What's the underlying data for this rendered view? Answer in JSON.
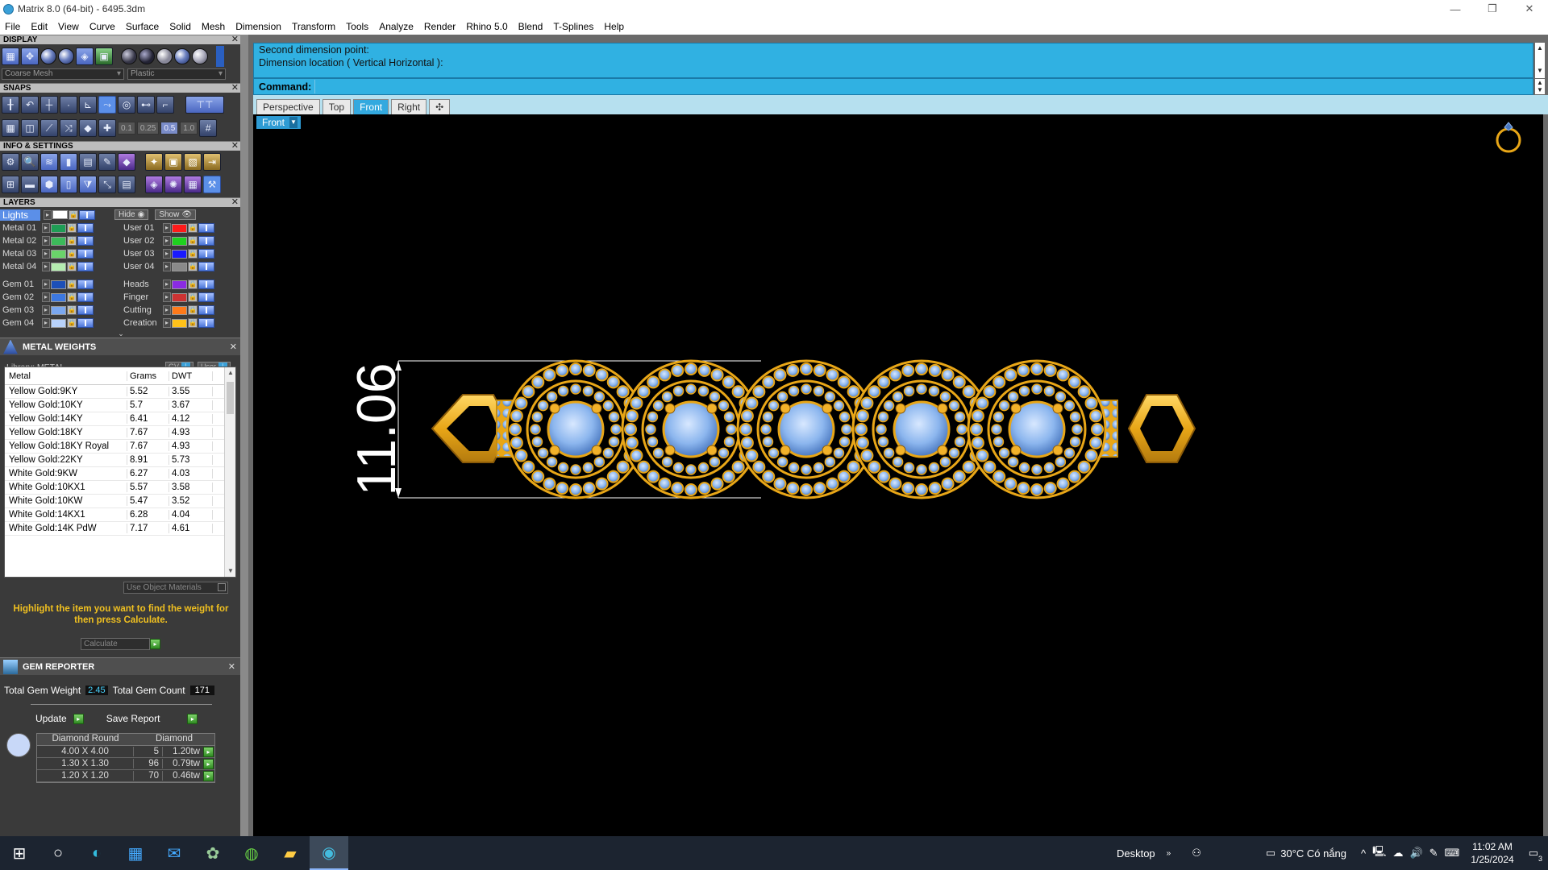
{
  "window": {
    "title": "Matrix 8.0 (64-bit) - 6495.3dm",
    "controls": [
      "—",
      "❐",
      "✕"
    ]
  },
  "menu": [
    "File",
    "Edit",
    "View",
    "Curve",
    "Surface",
    "Solid",
    "Mesh",
    "Dimension",
    "Transform",
    "Tools",
    "Analyze",
    "Render",
    "Rhino 5.0",
    "Blend",
    "T-Splines",
    "Help"
  ],
  "display": {
    "title": "DISPLAY",
    "mesh": "Coarse Mesh",
    "material": "Plastic"
  },
  "snaps": {
    "title": "SNAPS",
    "values": [
      "0.1",
      "0.25",
      "0.5",
      "1.0"
    ]
  },
  "info": {
    "title": "INFO & SETTINGS"
  },
  "layers": {
    "title": "LAYERS",
    "lights": "Lights",
    "hide": "Hide",
    "show": "Show",
    "left": [
      {
        "name": "Metal 01",
        "color": "#1f9d55"
      },
      {
        "name": "Metal 02",
        "color": "#3cb95a"
      },
      {
        "name": "Metal 03",
        "color": "#6ad36a"
      },
      {
        "name": "Metal 04",
        "color": "#b5ecb0"
      },
      {
        "name": "Gem 01",
        "color": "#1d4fb8"
      },
      {
        "name": "Gem 02",
        "color": "#3d78e0"
      },
      {
        "name": "Gem 03",
        "color": "#7aa7ef"
      },
      {
        "name": "Gem 04",
        "color": "#b8d2fb"
      }
    ],
    "right": [
      {
        "name": "User 01",
        "color": "#ff1a1a"
      },
      {
        "name": "User 02",
        "color": "#1fd11f"
      },
      {
        "name": "User 03",
        "color": "#1a1aff"
      },
      {
        "name": "User 04",
        "color": "#8a8a8a"
      },
      {
        "name": "Heads",
        "color": "#8a2be2"
      },
      {
        "name": "Finger",
        "color": "#cc3333"
      },
      {
        "name": "Cutting",
        "color": "#ff7a1a"
      },
      {
        "name": "Creation",
        "color": "#ffc21a"
      }
    ]
  },
  "metal_weights": {
    "title": "METAL WEIGHTS",
    "library": "Library: METAL",
    "gv": "GV",
    "user": "User",
    "headers": [
      "Metal",
      "Grams",
      "DWT"
    ],
    "rows": [
      [
        "Yellow Gold:9KY",
        "5.52",
        "3.55"
      ],
      [
        "Yellow Gold:10KY",
        "5.7",
        "3.67"
      ],
      [
        "Yellow Gold:14KY",
        "6.41",
        "4.12"
      ],
      [
        "Yellow Gold:18KY",
        "7.67",
        "4.93"
      ],
      [
        "Yellow Gold:18KY Royal",
        "7.67",
        "4.93"
      ],
      [
        "Yellow Gold:22KY",
        "8.91",
        "5.73"
      ],
      [
        "White Gold:9KW",
        "6.27",
        "4.03"
      ],
      [
        "White Gold:10KX1",
        "5.57",
        "3.58"
      ],
      [
        "White Gold:10KW",
        "5.47",
        "3.52"
      ],
      [
        "White Gold:14KX1",
        "6.28",
        "4.04"
      ],
      [
        "White Gold:14K PdW",
        "7.17",
        "4.61"
      ]
    ],
    "use_object_materials": "Use Object Materials",
    "hint": "Highlight the item you want to find the weight for then press Calculate.",
    "calculate": "Calculate"
  },
  "gem_reporter": {
    "title": "GEM REPORTER",
    "total_weight_label": "Total Gem Weight",
    "total_weight": "2.45",
    "total_count_label": "Total Gem Count",
    "total_count": "171",
    "update": "Update",
    "save_report": "Save Report",
    "headers": [
      "Diamond Round",
      "Diamond"
    ],
    "rows": [
      [
        "4.00 X 4.00",
        "5",
        "1.20tw"
      ],
      [
        "1.30 X 1.30",
        "96",
        "0.79tw"
      ],
      [
        "1.20 X 1.20",
        "70",
        "0.46tw"
      ]
    ]
  },
  "command": {
    "history": [
      "Second dimension point:",
      "Dimension location ( Vertical  Horizontal ):"
    ],
    "label": "Command:"
  },
  "viewtabs": [
    "Perspective",
    "Top",
    "Front",
    "Right",
    "✣"
  ],
  "active_view": "Front",
  "dimension_value": "11.06",
  "taskbar": {
    "desktop": "Desktop",
    "weather": "30°C  Có nắng",
    "time": "11:02 AM",
    "date": "1/25/2024",
    "notifications": "3"
  },
  "colors": {
    "accent": "#30b1e2",
    "gold": "#e8a617",
    "gem": "#8cb6ee"
  }
}
